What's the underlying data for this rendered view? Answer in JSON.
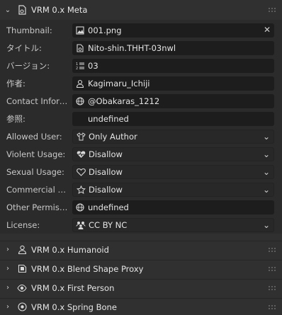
{
  "meta_panel": {
    "title": "VRM 0.x Meta",
    "fields": [
      {
        "label": "Thumbnail:",
        "value": "001.png",
        "icon": "image-icon",
        "control": "text-clear"
      },
      {
        "label": "タイトル:",
        "value": "Nito-shin.THHT-03nwl",
        "icon": "file-icon",
        "control": "text"
      },
      {
        "label": "バージョン:",
        "value": "03",
        "icon": "numbered-list-icon",
        "control": "text"
      },
      {
        "label": "作者:",
        "value": "Kagimaru_Ichiji",
        "icon": "user-icon",
        "control": "text"
      },
      {
        "label": "Contact Inform···",
        "value": "@Obakaras_1212",
        "icon": "globe-icon",
        "control": "text"
      },
      {
        "label": "参照:",
        "value": "undefined",
        "icon": "",
        "control": "text"
      },
      {
        "label": "Allowed User:",
        "value": "Only Author",
        "icon": "shirt-icon",
        "control": "dropdown"
      },
      {
        "label": "Violent Usage:",
        "value": "Disallow",
        "icon": "heartbeat-icon",
        "control": "dropdown"
      },
      {
        "label": "Sexual Usage:",
        "value": "Disallow",
        "icon": "heart-icon",
        "control": "dropdown"
      },
      {
        "label": "Commercial Us···",
        "value": "Disallow",
        "icon": "star-icon",
        "control": "dropdown"
      },
      {
        "label": "Other Permissio···",
        "value": "undefined",
        "icon": "globe-icon",
        "control": "text"
      },
      {
        "label": "License:",
        "value": "CC BY NC",
        "icon": "community-icon",
        "control": "dropdown"
      }
    ]
  },
  "collapsed_panels": [
    {
      "title": "VRM 0.x Humanoid",
      "icon": "armature-user-icon"
    },
    {
      "title": "VRM 0.x Blend Shape Proxy",
      "icon": "shape-key-icon"
    },
    {
      "title": "VRM 0.x First Person",
      "icon": "eye-icon"
    },
    {
      "title": "VRM 0.x Spring Bone",
      "icon": "physics-icon"
    }
  ]
}
